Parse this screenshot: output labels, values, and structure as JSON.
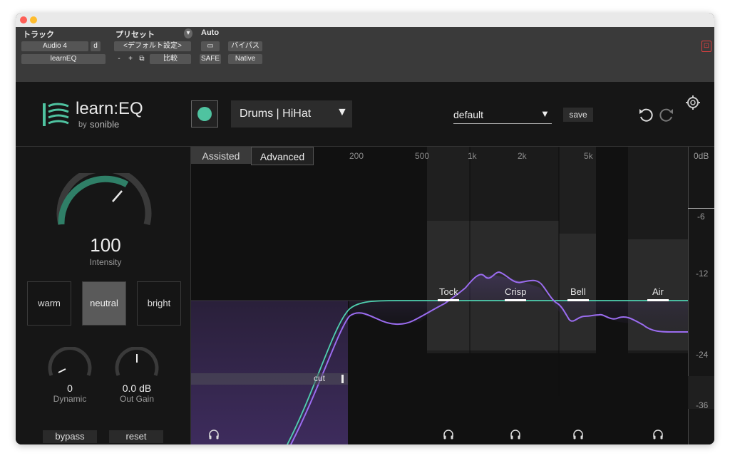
{
  "host": {
    "track_label": "トラック",
    "preset_label": "プリセット",
    "auto_label": "Auto",
    "track_name": "Audio 4",
    "track_mode": "d",
    "insert_name": "learnEQ",
    "preset_value": "<デフォルト設定>",
    "preset_minus": "-",
    "preset_plus": "+",
    "compare_label": "比較",
    "safe_label": "SAFE",
    "bypass_label": "バイパス",
    "native_label": "Native"
  },
  "plugin": {
    "logo_main": "learn:EQ",
    "logo_by": "by",
    "logo_brand": "sonible",
    "profile": "Drums | HiHat",
    "preset": "default",
    "save_label": "save",
    "colors": {
      "accent": "#4fc3a0",
      "curve": "#9b6cf0"
    }
  },
  "left": {
    "intensity_value": "100",
    "intensity_label": "Intensity",
    "intensity_level": 100,
    "tone": {
      "warm": "warm",
      "neutral": "neutral",
      "bright": "bright",
      "selected": "neutral"
    },
    "dynamic_value": "0",
    "dynamic_label": "Dynamic",
    "outgain_value": "0.0 dB",
    "outgain_label": "Out Gain",
    "bypass_label": "bypass",
    "reset_label": "reset"
  },
  "eq": {
    "tabs": {
      "assisted": "Assisted",
      "advanced": "Advanced",
      "active": "Advanced"
    },
    "freq_labels": [
      "200",
      "500",
      "1k",
      "2k",
      "5k"
    ],
    "db_labels": [
      "0dB",
      "-6",
      "-12",
      "-24",
      "-36"
    ],
    "bands": [
      "Tock",
      "Crisp",
      "Bell",
      "Air"
    ],
    "cut_label": "cut"
  }
}
